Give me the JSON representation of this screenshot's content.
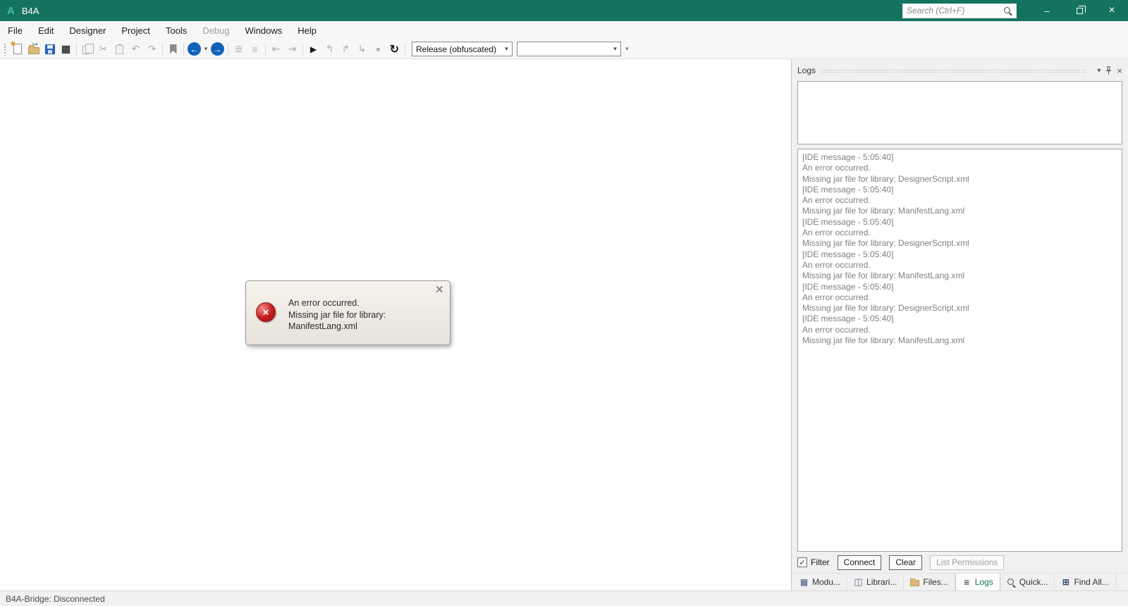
{
  "titlebar": {
    "app_title": "B4A",
    "logo": "A",
    "search": {
      "placeholder": "Search (Ctrl+F)"
    }
  },
  "menu": {
    "items": [
      {
        "label": "File"
      },
      {
        "label": "Edit"
      },
      {
        "label": "Designer"
      },
      {
        "label": "Project"
      },
      {
        "label": "Tools"
      },
      {
        "label": "Debug",
        "disabled": true
      },
      {
        "label": "Windows"
      },
      {
        "label": "Help"
      }
    ]
  },
  "toolbar": {
    "build_configuration": "Release (obfuscated)",
    "module_selector": ""
  },
  "editor": {
    "error_popup": {
      "line1": "An error occurred.",
      "line2": "Missing jar file for library:",
      "line3": "ManifestLang.xml"
    }
  },
  "logs_panel": {
    "title": "Logs",
    "entries": [
      {
        "header": "[IDE message - 5:05:40]",
        "line1": "An error occurred.",
        "line2": "Missing jar file for library: DesignerScript.xml"
      },
      {
        "header": "[IDE message - 5:05:40]",
        "line1": "An error occurred.",
        "line2": "Missing jar file for library: ManifestLang.xml"
      },
      {
        "header": "[IDE message - 5:05:40]",
        "line1": "An error occurred.",
        "line2": "Missing jar file for library: DesignerScript.xml"
      },
      {
        "header": "[IDE message - 5:05:40]",
        "line1": "An error occurred.",
        "line2": "Missing jar file for library: ManifestLang.xml"
      },
      {
        "header": "[IDE message - 5:05:40]",
        "line1": "An error occurred.",
        "line2": "Missing jar file for library: DesignerScript.xml"
      },
      {
        "header": "[IDE message - 5:05:40]",
        "line1": "An error occurred.",
        "line2": "Missing jar file for library: ManifestLang.xml"
      }
    ],
    "filter_label": "Filter",
    "connect_label": "Connect",
    "clear_label": "Clear",
    "list_permissions_label": "List Permissions"
  },
  "bottom_tabs": [
    {
      "label": "Modu...",
      "icon": "modules-icon"
    },
    {
      "label": "Librari...",
      "icon": "libraries-icon"
    },
    {
      "label": "Files...",
      "icon": "files-icon"
    },
    {
      "label": "Logs",
      "icon": "logs-icon",
      "active": true
    },
    {
      "label": "Quick...",
      "icon": "quick-search-icon"
    },
    {
      "label": "Find All...",
      "icon": "find-all-icon"
    }
  ],
  "statusbar": {
    "bridge_status": "B4A-Bridge: Disconnected"
  },
  "icons": {
    "cut": "✂",
    "undo": "↶",
    "redo": "↷",
    "package": "▦",
    "comment_selection": "≣",
    "uncomment_selection": "≡",
    "indent_left": "⇤",
    "indent_right": "⇥",
    "run": "▶",
    "step_into": "↰",
    "step_over": "↱",
    "step_out": "↳",
    "stop": "■",
    "rebuild": "↻",
    "caret": "▾",
    "back_arrow": "←",
    "forward_arrow": "→",
    "close": "×",
    "minimize": "–",
    "check": "✓",
    "error_x": "×"
  },
  "colors": {
    "titlebar_teal": "#14735F",
    "logo_teal": "#3EC3A4",
    "nav_blue": "#1262B8",
    "active_tab_teal": "#16735F",
    "error_red": "#C01818"
  }
}
